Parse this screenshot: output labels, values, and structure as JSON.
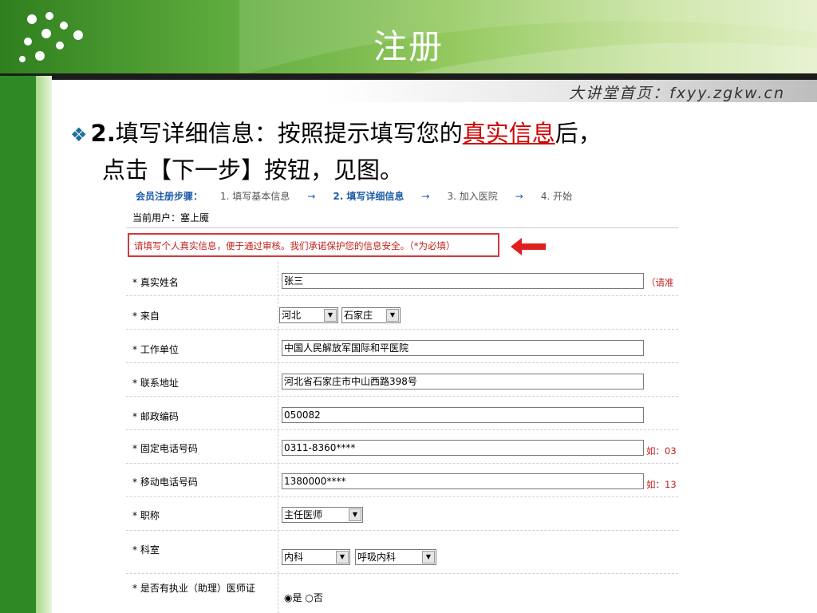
{
  "slide": {
    "title": "注册",
    "site": "大讲堂首页：fxyy.zgkw.cn",
    "bullet": {
      "number": "2.",
      "text_a": "填写详细信息：按照提示填写您的",
      "highlight": "真实信息",
      "text_b": "后，",
      "line2": "点击【下一步】按钮，见图。"
    },
    "colors": {
      "green": "#2f8a25",
      "highlight": "#d00000",
      "link_blue": "#1f5da8",
      "warn_red": "#c0201e"
    }
  },
  "form": {
    "steps": {
      "label": "会员注册步骤：",
      "step1": "1. 填写基本信息",
      "arrow": "→",
      "step2": "2. 填写详细信息",
      "step3": "3. 加入医院",
      "step4": "4. 开始"
    },
    "current_user": "当前用户：塞上魇",
    "notice": "请填写个人真实信息，便于通过审核。我们承诺保护您的信息安全。（*为必填）",
    "fields": {
      "real_name": {
        "label": "* 真实姓名",
        "value": "张三",
        "hint": "（请准"
      },
      "from": {
        "label": "* 来自",
        "province": "河北",
        "city": "石家庄"
      },
      "work_unit": {
        "label": "* 工作单位",
        "value": "中国人民解放军国际和平医院"
      },
      "address": {
        "label": "* 联系地址",
        "value": "河北省石家庄市中山西路398号"
      },
      "postcode": {
        "label": "* 邮政编码",
        "value": "050082"
      },
      "phone": {
        "label": "* 固定电话号码",
        "value": "0311-8360****",
        "hint": "如：03"
      },
      "mobile": {
        "label": "* 移动电话号码",
        "value": "1380000****",
        "hint": "如：13"
      },
      "title": {
        "label": "* 职称",
        "value": "主任医师"
      },
      "department": {
        "label": "* 科室",
        "dept": "内科",
        "subdept": "呼吸内科"
      },
      "license": {
        "label": "* 是否有执业（助理）医师证",
        "yes": "是",
        "no": "否",
        "selected": "是"
      }
    }
  }
}
